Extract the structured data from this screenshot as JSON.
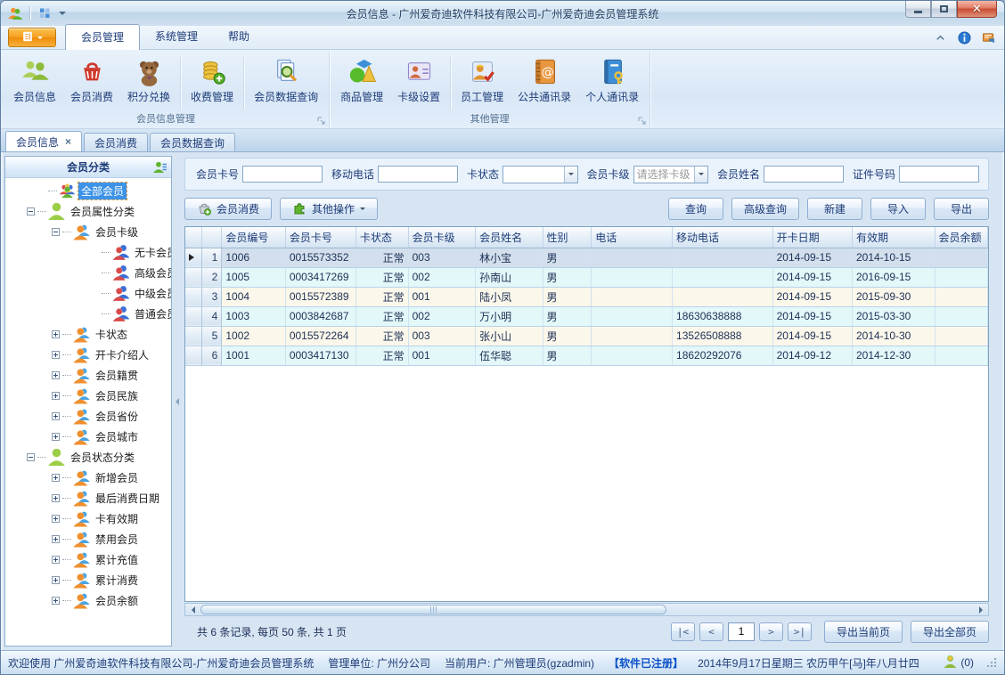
{
  "window": {
    "title": "会员信息 - 广州爱奇迪软件科技有限公司-广州爱奇迪会员管理系统"
  },
  "ribbon": {
    "tabs": [
      {
        "name": "member-management",
        "label": "会员管理",
        "active": true
      },
      {
        "name": "system-management",
        "label": "系统管理",
        "active": false
      },
      {
        "name": "help",
        "label": "帮助",
        "active": false
      }
    ],
    "groups": [
      {
        "name": "member-info-management",
        "label": "会员信息管理",
        "buttons": [
          {
            "name": "member-info",
            "label": "会员信息",
            "icon": "members-icon",
            "sep_after": false
          },
          {
            "name": "member-consume",
            "label": "会员消费",
            "icon": "basket-icon",
            "sep_after": false
          },
          {
            "name": "points-exchange",
            "label": "积分兑换",
            "icon": "bear-icon",
            "sep_after": true
          },
          {
            "name": "fee-management",
            "label": "收费管理",
            "icon": "coins-icon",
            "sep_after": true
          },
          {
            "name": "member-data-query",
            "label": "会员数据查询",
            "icon": "doc-search-icon",
            "sep_after": false
          }
        ]
      },
      {
        "name": "other-management",
        "label": "其他管理",
        "buttons": [
          {
            "name": "goods-management",
            "label": "商品管理",
            "icon": "goods-icon",
            "sep_after": false
          },
          {
            "name": "card-level-settings",
            "label": "卡级设置",
            "icon": "card-icon",
            "sep_after": true
          },
          {
            "name": "staff-management",
            "label": "员工管理",
            "icon": "staff-icon",
            "sep_after": false
          },
          {
            "name": "public-contacts",
            "label": "公共通讯录",
            "icon": "public-contacts-icon",
            "sep_after": false
          },
          {
            "name": "personal-contacts",
            "label": "个人通讯录",
            "icon": "personal-contacts-icon",
            "sep_after": false
          }
        ]
      }
    ]
  },
  "doc_tabs": [
    {
      "name": "member-info-tab",
      "label": "会员信息",
      "active": true,
      "closable": true
    },
    {
      "name": "member-consume-tab",
      "label": "会员消费",
      "active": false,
      "closable": false
    },
    {
      "name": "member-data-query-tab",
      "label": "会员数据查询",
      "active": false,
      "closable": false
    }
  ],
  "tree": {
    "header": "会员分类",
    "items": [
      {
        "name": "all-members",
        "label": "全部会员",
        "icon": "group-all-icon",
        "level": 0,
        "expander": "none",
        "selected": true
      },
      {
        "name": "member-attribute-category",
        "label": "会员属性分类",
        "icon": "person-green-icon",
        "level": 0,
        "expander": "minus",
        "selected": false
      },
      {
        "name": "member-card-level",
        "label": "会员卡级",
        "icon": "pair-orange-icon",
        "level": 1,
        "expander": "minus",
        "selected": false
      },
      {
        "name": "no-card-member",
        "label": "无卡会员",
        "icon": "pair-red-blue-icon",
        "level": 2,
        "expander": "none",
        "selected": false
      },
      {
        "name": "senior-member",
        "label": "高级会员",
        "icon": "pair-red-blue-icon",
        "level": 2,
        "expander": "none",
        "selected": false
      },
      {
        "name": "middle-member",
        "label": "中级会员",
        "icon": "pair-red-blue-icon",
        "level": 2,
        "expander": "none",
        "selected": false
      },
      {
        "name": "normal-member",
        "label": "普通会员",
        "icon": "pair-red-blue-icon",
        "level": 2,
        "expander": "none",
        "selected": false
      },
      {
        "name": "card-status",
        "label": "卡状态",
        "icon": "pair-orange-icon",
        "level": 1,
        "expander": "plus",
        "selected": false
      },
      {
        "name": "card-introducer",
        "label": "开卡介绍人",
        "icon": "pair-orange-icon",
        "level": 1,
        "expander": "plus",
        "selected": false
      },
      {
        "name": "member-native-place",
        "label": "会员籍贯",
        "icon": "pair-orange-icon",
        "level": 1,
        "expander": "plus",
        "selected": false
      },
      {
        "name": "member-ethnicity",
        "label": "会员民族",
        "icon": "pair-orange-icon",
        "level": 1,
        "expander": "plus",
        "selected": false
      },
      {
        "name": "member-province",
        "label": "会员省份",
        "icon": "pair-orange-icon",
        "level": 1,
        "expander": "plus",
        "selected": false
      },
      {
        "name": "member-city",
        "label": "会员城市",
        "icon": "pair-orange-icon",
        "level": 1,
        "expander": "plus",
        "selected": false
      },
      {
        "name": "member-status-category",
        "label": "会员状态分类",
        "icon": "person-green-icon",
        "level": 0,
        "expander": "minus",
        "selected": false
      },
      {
        "name": "new-members",
        "label": "新增会员",
        "icon": "pair-orange-icon",
        "level": 1,
        "expander": "plus",
        "selected": false
      },
      {
        "name": "last-consume-date",
        "label": "最后消费日期",
        "icon": "pair-orange-icon",
        "level": 1,
        "expander": "plus",
        "selected": false
      },
      {
        "name": "card-validity",
        "label": "卡有效期",
        "icon": "pair-orange-icon",
        "level": 1,
        "expander": "plus",
        "selected": false
      },
      {
        "name": "disabled-members",
        "label": "禁用会员",
        "icon": "pair-orange-icon",
        "level": 1,
        "expander": "plus",
        "selected": false
      },
      {
        "name": "total-recharge",
        "label": "累计充值",
        "icon": "pair-orange-icon",
        "level": 1,
        "expander": "plus",
        "selected": false
      },
      {
        "name": "total-consume",
        "label": "累计消费",
        "icon": "pair-orange-icon",
        "level": 1,
        "expander": "plus",
        "selected": false
      },
      {
        "name": "member-balance",
        "label": "会员余额",
        "icon": "pair-orange-icon",
        "level": 1,
        "expander": "plus",
        "selected": false
      }
    ]
  },
  "filters": [
    {
      "name": "member-card-no",
      "label": "会员卡号",
      "type": "input",
      "value": ""
    },
    {
      "name": "mobile-phone",
      "label": "移动电话",
      "type": "input",
      "value": ""
    },
    {
      "name": "card-status",
      "label": "卡状态",
      "type": "select",
      "value": ""
    },
    {
      "name": "member-card-level",
      "label": "会员卡级",
      "type": "select",
      "value": "请选择卡级"
    },
    {
      "name": "member-name",
      "label": "会员姓名",
      "type": "input",
      "value": ""
    },
    {
      "name": "id-number",
      "label": "证件号码",
      "type": "input",
      "value": ""
    }
  ],
  "grid_toolbar": {
    "left": [
      {
        "name": "member-consume-button",
        "label": "会员消费",
        "icon": "basket-plus-icon",
        "dropdown": false
      },
      {
        "name": "other-actions-button",
        "label": "其他操作",
        "icon": "puzzle-icon",
        "dropdown": true
      }
    ],
    "right": [
      {
        "name": "query-button",
        "label": "查询"
      },
      {
        "name": "advanced-query-button",
        "label": "高级查询"
      },
      {
        "name": "new-button",
        "label": "新建"
      },
      {
        "name": "import-button",
        "label": "导入"
      },
      {
        "name": "export-button",
        "label": "导出"
      }
    ]
  },
  "grid": {
    "columns": [
      {
        "name": "member-no",
        "label": "会员编号"
      },
      {
        "name": "card-no",
        "label": "会员卡号"
      },
      {
        "name": "card-status",
        "label": "卡状态",
        "align": "right"
      },
      {
        "name": "card-level",
        "label": "会员卡级"
      },
      {
        "name": "member-name",
        "label": "会员姓名"
      },
      {
        "name": "gender",
        "label": "性别"
      },
      {
        "name": "phone",
        "label": "电话"
      },
      {
        "name": "mobile",
        "label": "移动电话"
      },
      {
        "name": "open-date",
        "label": "开卡日期"
      },
      {
        "name": "valid-until",
        "label": "有效期"
      },
      {
        "name": "member-balance",
        "label": "会员余额"
      }
    ],
    "rows": [
      {
        "num": "1",
        "selected": true,
        "cells": [
          "1006",
          "0015573352",
          "正常",
          "003",
          "林小宝",
          "男",
          "",
          "",
          "2014-09-15",
          "2014-10-15",
          ""
        ]
      },
      {
        "num": "2",
        "selected": false,
        "cells": [
          "1005",
          "0003417269",
          "正常",
          "002",
          "孙南山",
          "男",
          "",
          "",
          "2014-09-15",
          "2016-09-15",
          ""
        ]
      },
      {
        "num": "3",
        "selected": false,
        "cells": [
          "1004",
          "0015572389",
          "正常",
          "001",
          "陆小凤",
          "男",
          "",
          "",
          "2014-09-15",
          "2015-09-30",
          ""
        ]
      },
      {
        "num": "4",
        "selected": false,
        "cells": [
          "1003",
          "0003842687",
          "正常",
          "002",
          "万小明",
          "男",
          "",
          "18630638888",
          "2014-09-15",
          "2015-03-30",
          ""
        ]
      },
      {
        "num": "5",
        "selected": false,
        "cells": [
          "1002",
          "0015572264",
          "正常",
          "003",
          "张小山",
          "男",
          "",
          "13526508888",
          "2014-09-15",
          "2014-10-30",
          ""
        ]
      },
      {
        "num": "6",
        "selected": false,
        "cells": [
          "1001",
          "0003417130",
          "正常",
          "001",
          "伍华聪",
          "男",
          "",
          "18620292076",
          "2014-09-12",
          "2014-12-30",
          ""
        ]
      }
    ]
  },
  "pager": {
    "summary": "共 6 条记录, 每页 50 条, 共 1 页",
    "first": "|<",
    "prev": "<",
    "page_value": "1",
    "next": ">",
    "last": ">|",
    "export_current": "导出当前页",
    "export_all": "导出全部页"
  },
  "statusbar": {
    "welcome": "欢迎使用 广州爱奇迪软件科技有限公司-广州爱奇迪会员管理系统",
    "org": "管理单位: 广州分公司",
    "user": "当前用户: 广州管理员(gzadmin)",
    "registered": "【软件已注册】",
    "date": "2014年9月17日星期三 农历甲午[马]年八月廿四",
    "count": "(0)"
  }
}
